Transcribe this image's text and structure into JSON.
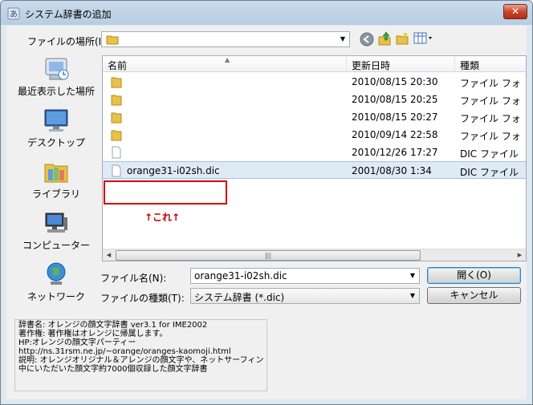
{
  "window": {
    "title": "システム辞書の追加",
    "close_label": "✕"
  },
  "lookin": {
    "label": "ファイルの場所(I):",
    "value": ""
  },
  "places": [
    {
      "label": "最近表示した場所",
      "icon": "recent-places-icon"
    },
    {
      "label": "デスクトップ",
      "icon": "desktop-icon"
    },
    {
      "label": "ライブラリ",
      "icon": "libraries-icon"
    },
    {
      "label": "コンピューター",
      "icon": "computer-icon"
    },
    {
      "label": "ネットワーク",
      "icon": "network-icon"
    }
  ],
  "columns": {
    "name": "名前",
    "date": "更新日時",
    "type": "種類"
  },
  "files": [
    {
      "name": "",
      "date": "2010/08/15 20:30",
      "type": "ファイル フォ",
      "icon": "folder-icon"
    },
    {
      "name": "",
      "date": "2010/08/15 20:25",
      "type": "ファイル フォ",
      "icon": "folder-icon"
    },
    {
      "name": "",
      "date": "2010/08/15 20:27",
      "type": "ファイル フォ",
      "icon": "folder-icon"
    },
    {
      "name": "",
      "date": "2010/09/14 22:58",
      "type": "ファイル フォ",
      "icon": "folder-icon"
    },
    {
      "name": "",
      "date": "2010/12/26 17:27",
      "type": "DIC ファイル",
      "icon": "file-icon"
    },
    {
      "name": "orange31-i02sh.dic",
      "date": "2001/08/30 1:34",
      "type": "DIC ファイル",
      "icon": "file-icon",
      "selected": true
    }
  ],
  "annotation": {
    "text": "↑これ↑"
  },
  "filename": {
    "label": "ファイル名(N):",
    "value": "orange31-i02sh.dic"
  },
  "filetype": {
    "label": "ファイルの種類(T):",
    "value": "システム辞書 (*.dic)"
  },
  "buttons": {
    "open": "開く(O)",
    "cancel": "キャンセル"
  },
  "info_lines": [
    "辞書名: オレンジの顔文字辞書 ver3.1 for IME2002",
    "著作権: 著作権はオレンジに帰属します。",
    "HP:オレンジの顔文字パーティー",
    "http://ns.31rsm.ne.jp/~orange/oranges-kaomoji.html",
    "説明: オレンジオリジナル＆アレンジの顔文字や、ネットサーフィン",
    "中にいただいた顔文字約7000個収録した顔文字辞書"
  ],
  "colors": {
    "selection": "#dfeaf7",
    "annotation": "#d50000",
    "folder": "#e8c24a"
  }
}
